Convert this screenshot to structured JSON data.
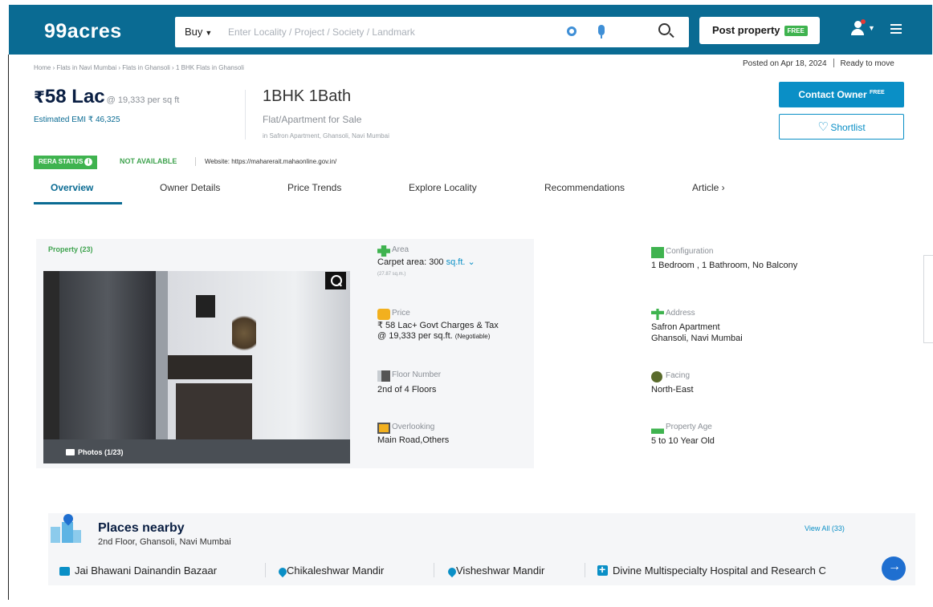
{
  "header": {
    "logo": "99acres",
    "search_type": "Buy",
    "search_placeholder": "Enter Locality / Project / Society / Landmark",
    "post_property": "Post property",
    "free_badge": "FREE"
  },
  "breadcrumb": "Home › Flats in Navi Mumbai › Flats in Ghansoli › 1 BHK Flats in Ghansoli",
  "posted": {
    "date": "Posted on Apr 18, 2024",
    "status": "Ready to move"
  },
  "listing": {
    "rupee": "₹",
    "price": "58 Lac",
    "price_per_sqft": "@ 19,333 per sq ft",
    "emi": "Estimated EMI ₹ 46,325",
    "config": "1BHK 1Bath",
    "sale_type": "Flat/Apartment for Sale",
    "society": "in Safron Apartment, Ghansoli, Navi Mumbai"
  },
  "actions": {
    "contact_owner": "Contact Owner",
    "contact_free": "FREE",
    "shortlist": "Shortlist"
  },
  "rera": {
    "badge": "RERA STATUS",
    "status": "NOT AVAILABLE",
    "website": "Website: https://maharerait.mahaonline.gov.in/"
  },
  "tabs": [
    "Overview",
    "Owner Details",
    "Price Trends",
    "Explore Locality",
    "Recommendations",
    "Article ›"
  ],
  "property": {
    "count_label": "Property (23)",
    "photos_label": "Photos (1/23)",
    "area": {
      "label": "Area",
      "value": "Carpet area: 300",
      "unit": "sq.ft.",
      "sub": "(27.87 sq.m.)"
    },
    "configuration": {
      "label": "Configuration",
      "value": "1 Bedroom , 1 Bathroom, No Balcony"
    },
    "price": {
      "label": "Price",
      "value": "₹ 58 Lac+ Govt Charges & Tax",
      "value2": "@ 19,333 per sq.ft.",
      "negotiable": "(Negotiable)"
    },
    "address": {
      "label": "Address",
      "value": "Safron Apartment",
      "value2": "Ghansoli, Navi Mumbai"
    },
    "floor": {
      "label": "Floor Number",
      "value": "2nd of 4 Floors"
    },
    "facing": {
      "label": "Facing",
      "value": "North-East"
    },
    "overlooking": {
      "label": "Overlooking",
      "value": "Main Road,Others"
    },
    "age": {
      "label": "Property Age",
      "value": "5 to 10 Year Old"
    }
  },
  "places": {
    "title": "Places nearby",
    "subtitle": "2nd Floor, Ghansoli, Navi Mumbai",
    "view_all": "View All (33)",
    "items": [
      "Jai Bhawani Dainandin Bazaar",
      "Chikaleshwar Mandir",
      "Visheshwar Mandir",
      "Divine Multispecialty Hospital and Research C"
    ]
  },
  "colors": {
    "brand": "#0a6b93",
    "accent": "#0a8fc6",
    "green": "#3fb34f"
  }
}
